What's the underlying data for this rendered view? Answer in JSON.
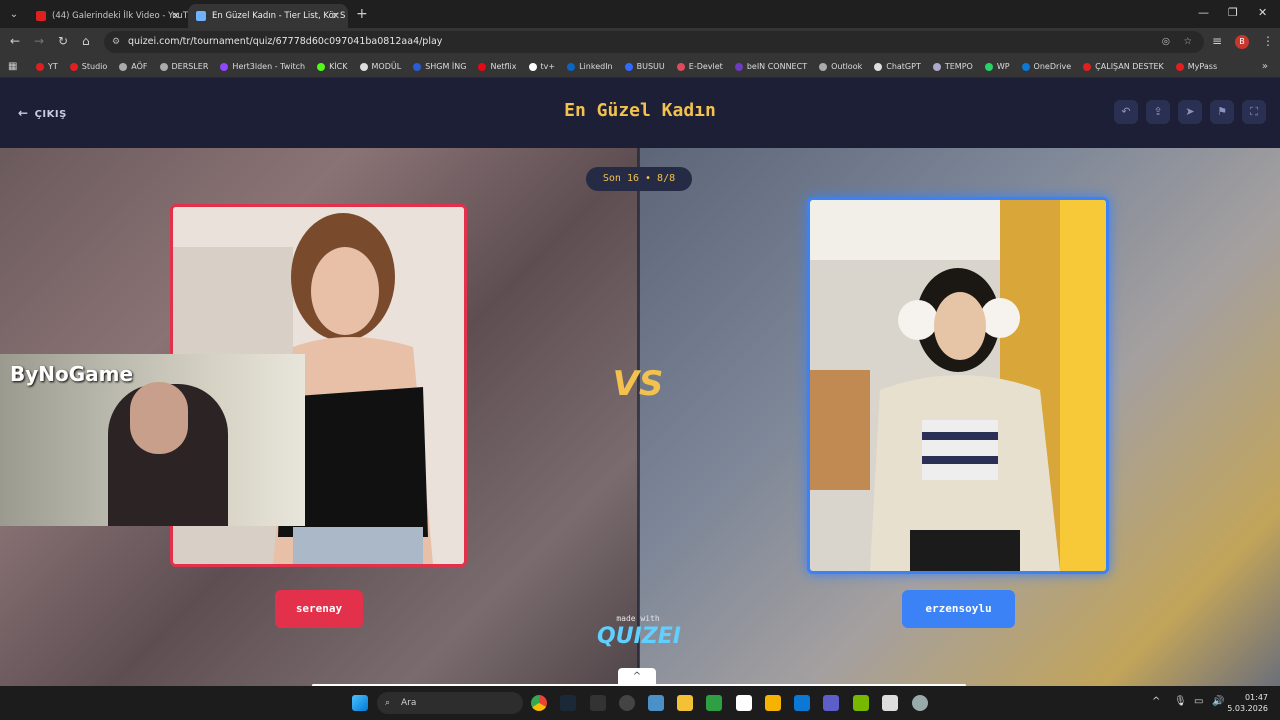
{
  "browser": {
    "tabs": [
      {
        "title": "(44) Galerindeki İlk Video - YouT",
        "active": false
      },
      {
        "title": "En Güzel Kadın - Tier List, Kör S",
        "active": true
      }
    ],
    "url": "quizei.com/tr/tournament/quiz/67778d60c097041ba0812aa4/play",
    "profile_initial": "B",
    "bookmarks": [
      "YT",
      "Studio",
      "AÖF",
      "DERSLER",
      "Hert3lden - Twitch",
      "KİCK",
      "MODÜL",
      "SHGM İNG",
      "Netflix",
      "tv+",
      "LinkedIn",
      "BUSUU",
      "E-Devlet",
      "beIN CONNECT",
      "Outlook",
      "ChatGPT",
      "TEMPO",
      "WP",
      "OneDrive",
      "ÇALIŞAN DESTEK",
      "MyPass"
    ]
  },
  "page": {
    "exit_label": "ÇIKIŞ",
    "title": "En Güzel Kadın",
    "round_label": "Son 16 • 8/8",
    "vs_label": "VS",
    "left_name": "serenay",
    "right_name": "erzensoylu",
    "made_with": "made with",
    "logo": "QUIZEI",
    "colors": {
      "left_accent": "#e3304b",
      "right_accent": "#3b82f6",
      "title": "#f2c14e"
    }
  },
  "overlay": {
    "webcam_brand": "ByNoGame"
  },
  "taskbar": {
    "search_placeholder": "Ara",
    "time": "01:47",
    "date": "5.03.2026"
  }
}
